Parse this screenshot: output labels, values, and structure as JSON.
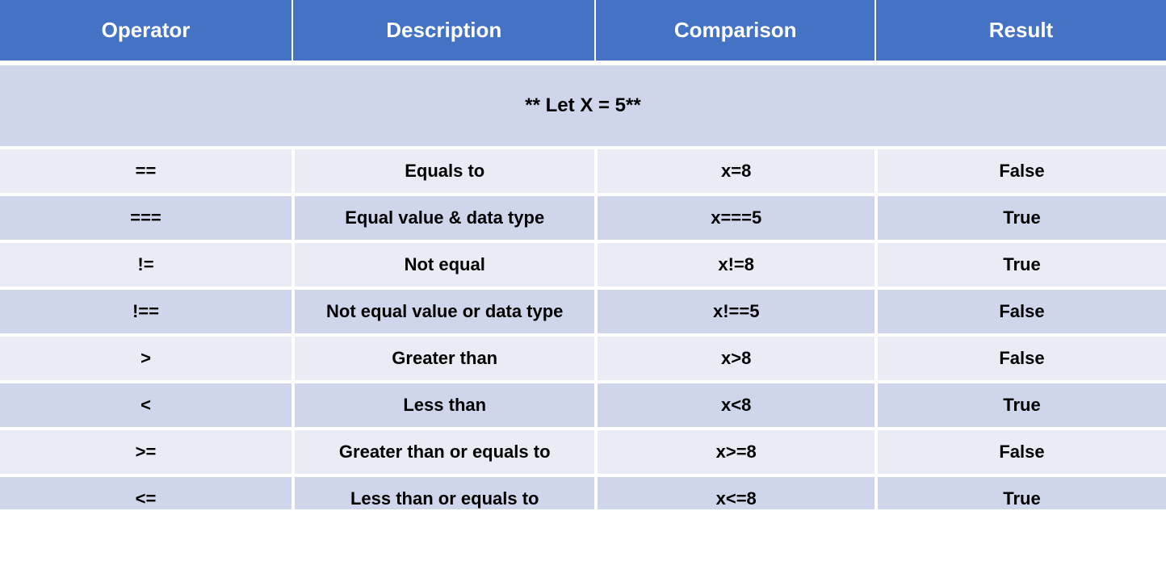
{
  "headers": {
    "operator": "Operator",
    "description": "Description",
    "comparison": "Comparison",
    "result": "Result"
  },
  "banner": "** Let X = 5**",
  "rows": [
    {
      "operator": "==",
      "description": "Equals to",
      "comparison": "x=8",
      "result": "False"
    },
    {
      "operator": "===",
      "description": "Equal value & data type",
      "comparison": "x===5",
      "result": "True"
    },
    {
      "operator": "!=",
      "description": "Not equal",
      "comparison": "x!=8",
      "result": "True"
    },
    {
      "operator": "!==",
      "description": "Not equal value or data type",
      "comparison": "x!==5",
      "result": "False"
    },
    {
      "operator": ">",
      "description": "Greater than",
      "comparison": "x>8",
      "result": "False"
    },
    {
      "operator": "<",
      "description": "Less than",
      "comparison": "x<8",
      "result": "True"
    },
    {
      "operator": ">=",
      "description": "Greater than or equals to",
      "comparison": "x>=8",
      "result": "False"
    },
    {
      "operator": "<=",
      "description": "Less than or equals to",
      "comparison": "x<=8",
      "result": "True"
    }
  ],
  "chart_data": {
    "type": "table",
    "columns": [
      "Operator",
      "Description",
      "Comparison",
      "Result"
    ],
    "note": "Let X = 5",
    "rows": [
      [
        "==",
        "Equals to",
        "x=8",
        "False"
      ],
      [
        "===",
        "Equal value & data type",
        "x===5",
        "True"
      ],
      [
        "!=",
        "Not equal",
        "x!=8",
        "True"
      ],
      [
        "!==",
        "Not equal value or data type",
        "x!==5",
        "False"
      ],
      [
        ">",
        "Greater than",
        "x>8",
        "False"
      ],
      [
        "<",
        "Less than",
        "x<8",
        "True"
      ],
      [
        ">=",
        "Greater than or equals to",
        "x>=8",
        "False"
      ],
      [
        "<=",
        "Less than or equals to",
        "x<=8",
        "True"
      ]
    ]
  }
}
